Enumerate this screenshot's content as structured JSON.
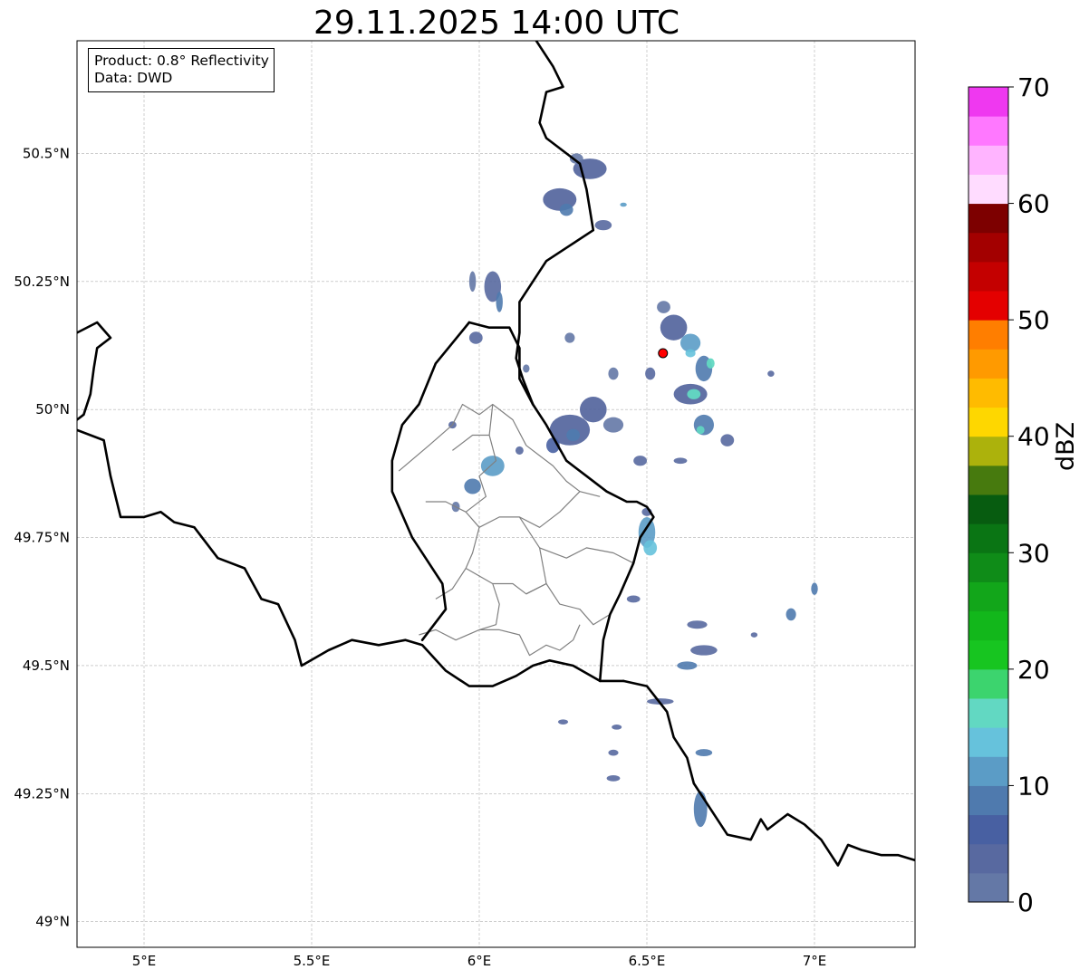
{
  "title": "29.11.2025 14:00 UTC",
  "info": {
    "product": "Product: 0.8° Reflectivity",
    "data": "Data: DWD"
  },
  "map": {
    "lon_range": [
      4.8,
      7.3
    ],
    "lat_range": [
      48.95,
      50.72
    ],
    "x_ticks": [
      {
        "value": 5.0,
        "label": "5°E"
      },
      {
        "value": 5.5,
        "label": "5.5°E"
      },
      {
        "value": 6.0,
        "label": "6°E"
      },
      {
        "value": 6.5,
        "label": "6.5°E"
      },
      {
        "value": 7.0,
        "label": "7°E"
      }
    ],
    "y_ticks": [
      {
        "value": 49.0,
        "label": "49°N"
      },
      {
        "value": 49.25,
        "label": "49.25°N"
      },
      {
        "value": 49.5,
        "label": "49.5°N"
      },
      {
        "value": 49.75,
        "label": "49.75°N"
      },
      {
        "value": 50.0,
        "label": "50°N"
      },
      {
        "value": 50.25,
        "label": "50.25°N"
      },
      {
        "value": 50.5,
        "label": "50.5°N"
      }
    ],
    "gridlines": true,
    "radar_site": {
      "lon": 6.548,
      "lat": 50.11,
      "color": "#ff0000"
    }
  },
  "colorbar": {
    "label": "dBZ",
    "min": 0,
    "max": 70,
    "step": 2.5,
    "ticks": [
      0,
      10,
      20,
      30,
      40,
      50,
      60,
      70
    ],
    "colors": [
      "#6478a6",
      "#5869a0",
      "#4860a2",
      "#4f7aae",
      "#5b9cc6",
      "#66c2dc",
      "#62d8c2",
      "#3cd46e",
      "#17c520",
      "#12b71b",
      "#12a61a",
      "#0f8c18",
      "#0a7514",
      "#075c10",
      "#477a0e",
      "#acb20c",
      "#fed700",
      "#ffbb00",
      "#ff9a00",
      "#ff7e00",
      "#e40000",
      "#c40000",
      "#a30000",
      "#7d0000",
      "#ffdcff",
      "#ffb4ff",
      "#ff78ff",
      "#ef38f0"
    ]
  },
  "borders": {
    "national": [
      [
        [
          4.8,
          50.15
        ],
        [
          4.86,
          50.17
        ],
        [
          4.9,
          50.14
        ],
        [
          4.86,
          50.12
        ],
        [
          4.85,
          50.08
        ],
        [
          4.84,
          50.03
        ],
        [
          4.82,
          49.99
        ],
        [
          4.8,
          49.98
        ]
      ],
      [
        [
          4.8,
          49.96
        ],
        [
          4.88,
          49.94
        ],
        [
          4.9,
          49.87
        ],
        [
          4.93,
          49.79
        ],
        [
          5.0,
          49.79
        ],
        [
          5.05,
          49.8
        ],
        [
          5.09,
          49.78
        ],
        [
          5.15,
          49.77
        ],
        [
          5.22,
          49.71
        ],
        [
          5.3,
          49.69
        ],
        [
          5.35,
          49.63
        ],
        [
          5.4,
          49.62
        ],
        [
          5.45,
          49.55
        ],
        [
          5.47,
          49.5
        ],
        [
          5.55,
          49.53
        ],
        [
          5.62,
          49.55
        ],
        [
          5.7,
          49.54
        ],
        [
          5.78,
          49.55
        ],
        [
          5.83,
          49.54
        ],
        [
          5.9,
          49.49
        ],
        [
          5.97,
          49.46
        ],
        [
          6.04,
          49.46
        ],
        [
          6.11,
          49.48
        ],
        [
          6.16,
          49.5
        ],
        [
          6.21,
          49.51
        ],
        [
          6.28,
          49.5
        ],
        [
          6.36,
          49.47
        ],
        [
          6.43,
          49.47
        ]
      ],
      [
        [
          6.43,
          49.47
        ],
        [
          6.5,
          49.46
        ],
        [
          6.56,
          49.41
        ],
        [
          6.58,
          49.36
        ],
        [
          6.62,
          49.32
        ],
        [
          6.64,
          49.27
        ],
        [
          6.69,
          49.22
        ],
        [
          6.74,
          49.17
        ],
        [
          6.81,
          49.16
        ],
        [
          6.84,
          49.2
        ],
        [
          6.86,
          49.18
        ],
        [
          6.92,
          49.21
        ],
        [
          6.97,
          49.19
        ],
        [
          7.02,
          49.16
        ],
        [
          7.05,
          49.13
        ],
        [
          7.07,
          49.11
        ],
        [
          7.1,
          49.15
        ],
        [
          7.14,
          49.14
        ],
        [
          7.2,
          49.13
        ],
        [
          7.25,
          49.13
        ],
        [
          7.3,
          49.12
        ]
      ],
      [
        [
          6.36,
          49.47
        ],
        [
          6.37,
          49.55
        ],
        [
          6.39,
          49.6
        ],
        [
          6.42,
          49.64
        ],
        [
          6.46,
          49.7
        ],
        [
          6.48,
          49.75
        ],
        [
          6.52,
          49.79
        ],
        [
          6.5,
          49.81
        ],
        [
          6.47,
          49.82
        ],
        [
          6.44,
          49.82
        ],
        [
          6.38,
          49.84
        ],
        [
          6.32,
          49.87
        ],
        [
          6.26,
          49.9
        ],
        [
          6.2,
          49.97
        ],
        [
          6.16,
          50.01
        ],
        [
          6.12,
          50.06
        ],
        [
          6.12,
          50.12
        ],
        [
          6.09,
          50.16
        ],
        [
          6.03,
          50.16
        ],
        [
          5.97,
          50.17
        ]
      ],
      [
        [
          5.97,
          50.17
        ],
        [
          5.92,
          50.13
        ],
        [
          5.87,
          50.09
        ],
        [
          5.82,
          50.01
        ],
        [
          5.77,
          49.97
        ],
        [
          5.74,
          49.9
        ],
        [
          5.74,
          49.84
        ],
        [
          5.8,
          49.75
        ],
        [
          5.84,
          49.71
        ],
        [
          5.89,
          49.66
        ],
        [
          5.9,
          49.61
        ],
        [
          5.83,
          49.55
        ]
      ],
      [
        [
          6.16,
          50.01
        ],
        [
          6.13,
          50.06
        ],
        [
          6.11,
          50.1
        ],
        [
          6.12,
          50.15
        ],
        [
          6.12,
          50.21
        ],
        [
          6.16,
          50.25
        ],
        [
          6.2,
          50.29
        ],
        [
          6.27,
          50.32
        ],
        [
          6.34,
          50.35
        ],
        [
          6.32,
          50.43
        ],
        [
          6.3,
          50.48
        ],
        [
          6.2,
          50.53
        ],
        [
          6.18,
          50.56
        ],
        [
          6.2,
          50.62
        ],
        [
          6.25,
          50.63
        ],
        [
          6.22,
          50.67
        ],
        [
          6.17,
          50.72
        ]
      ]
    ],
    "regional": [
      [
        [
          5.76,
          49.88
        ],
        [
          5.85,
          49.93
        ],
        [
          5.92,
          49.97
        ],
        [
          5.95,
          50.01
        ],
        [
          6.0,
          49.99
        ],
        [
          6.04,
          50.01
        ],
        [
          6.1,
          49.98
        ],
        [
          6.14,
          49.93
        ],
        [
          6.18,
          49.91
        ],
        [
          6.22,
          49.89
        ],
        [
          6.26,
          49.86
        ],
        [
          6.3,
          49.84
        ]
      ],
      [
        [
          6.04,
          50.01
        ],
        [
          6.03,
          49.95
        ],
        [
          6.05,
          49.9
        ],
        [
          6.0,
          49.87
        ],
        [
          6.02,
          49.83
        ],
        [
          5.96,
          49.8
        ],
        [
          5.9,
          49.82
        ],
        [
          5.84,
          49.82
        ]
      ],
      [
        [
          6.03,
          49.95
        ],
        [
          5.98,
          49.95
        ],
        [
          5.92,
          49.92
        ]
      ],
      [
        [
          5.96,
          49.8
        ],
        [
          6.0,
          49.77
        ],
        [
          6.06,
          49.79
        ],
        [
          6.12,
          49.79
        ],
        [
          6.18,
          49.77
        ],
        [
          6.24,
          49.8
        ],
        [
          6.3,
          49.84
        ],
        [
          6.36,
          49.83
        ]
      ],
      [
        [
          6.0,
          49.77
        ],
        [
          5.98,
          49.72
        ],
        [
          5.96,
          49.69
        ]
      ],
      [
        [
          6.12,
          49.79
        ],
        [
          6.18,
          49.73
        ],
        [
          6.26,
          49.71
        ],
        [
          6.32,
          49.73
        ],
        [
          6.4,
          49.72
        ],
        [
          6.46,
          49.7
        ]
      ],
      [
        [
          6.18,
          49.73
        ],
        [
          6.2,
          49.66
        ],
        [
          6.14,
          49.64
        ]
      ],
      [
        [
          5.96,
          49.69
        ],
        [
          6.04,
          49.66
        ],
        [
          6.1,
          49.66
        ],
        [
          6.14,
          49.64
        ],
        [
          6.2,
          49.66
        ],
        [
          6.24,
          49.62
        ],
        [
          6.3,
          49.61
        ],
        [
          6.34,
          49.58
        ],
        [
          6.39,
          49.6
        ]
      ],
      [
        [
          6.04,
          49.66
        ],
        [
          6.06,
          49.62
        ],
        [
          6.05,
          49.58
        ],
        [
          6.0,
          49.57
        ]
      ],
      [
        [
          5.87,
          49.63
        ],
        [
          5.92,
          49.65
        ],
        [
          5.96,
          49.69
        ]
      ],
      [
        [
          6.0,
          49.57
        ],
        [
          6.06,
          49.57
        ],
        [
          6.12,
          49.56
        ],
        [
          6.15,
          49.52
        ],
        [
          6.2,
          49.54
        ],
        [
          6.24,
          49.53
        ],
        [
          6.28,
          49.55
        ],
        [
          6.3,
          49.58
        ]
      ],
      [
        [
          5.82,
          49.56
        ],
        [
          5.87,
          49.57
        ],
        [
          5.93,
          49.55
        ],
        [
          6.0,
          49.57
        ]
      ]
    ]
  },
  "echoes": [
    {
      "lon": 6.24,
      "lat": 50.41,
      "rx": 0.05,
      "ry": 0.022,
      "c": "#5869a0",
      "o": 0.95
    },
    {
      "lon": 6.26,
      "lat": 50.39,
      "rx": 0.02,
      "ry": 0.012,
      "c": "#4f7aae",
      "o": 0.9
    },
    {
      "lon": 6.33,
      "lat": 50.47,
      "rx": 0.05,
      "ry": 0.02,
      "c": "#5869a0",
      "o": 0.95
    },
    {
      "lon": 6.29,
      "lat": 50.49,
      "rx": 0.02,
      "ry": 0.01,
      "c": "#6478a6",
      "o": 0.9
    },
    {
      "lon": 6.37,
      "lat": 50.36,
      "rx": 0.025,
      "ry": 0.01,
      "c": "#5869a0",
      "o": 0.9
    },
    {
      "lon": 6.43,
      "lat": 50.4,
      "rx": 0.01,
      "ry": 0.004,
      "c": "#5b9cc6",
      "o": 0.9
    },
    {
      "lon": 6.04,
      "lat": 50.24,
      "rx": 0.025,
      "ry": 0.03,
      "c": "#5869a0",
      "o": 0.9
    },
    {
      "lon": 5.98,
      "lat": 50.25,
      "rx": 0.01,
      "ry": 0.02,
      "c": "#6478a6",
      "o": 0.9
    },
    {
      "lon": 6.06,
      "lat": 50.21,
      "rx": 0.01,
      "ry": 0.02,
      "c": "#4f7aae",
      "o": 0.9
    },
    {
      "lon": 5.99,
      "lat": 50.14,
      "rx": 0.02,
      "ry": 0.012,
      "c": "#5869a0",
      "o": 0.9
    },
    {
      "lon": 6.27,
      "lat": 49.96,
      "rx": 0.06,
      "ry": 0.03,
      "c": "#5869a0",
      "o": 0.95
    },
    {
      "lon": 6.28,
      "lat": 49.95,
      "rx": 0.02,
      "ry": 0.012,
      "c": "#4f7aae",
      "o": 0.95
    },
    {
      "lon": 6.34,
      "lat": 50.0,
      "rx": 0.04,
      "ry": 0.025,
      "c": "#5869a0",
      "o": 0.95
    },
    {
      "lon": 6.4,
      "lat": 49.97,
      "rx": 0.03,
      "ry": 0.015,
      "c": "#6478a6",
      "o": 0.9
    },
    {
      "lon": 6.22,
      "lat": 49.93,
      "rx": 0.02,
      "ry": 0.015,
      "c": "#4860a2",
      "o": 0.9
    },
    {
      "lon": 6.04,
      "lat": 49.89,
      "rx": 0.035,
      "ry": 0.02,
      "c": "#5b9cc6",
      "o": 0.9
    },
    {
      "lon": 5.98,
      "lat": 49.85,
      "rx": 0.025,
      "ry": 0.015,
      "c": "#4f7aae",
      "o": 0.9
    },
    {
      "lon": 5.93,
      "lat": 49.81,
      "rx": 0.012,
      "ry": 0.01,
      "c": "#6478a6",
      "o": 0.9
    },
    {
      "lon": 5.92,
      "lat": 49.97,
      "rx": 0.012,
      "ry": 0.007,
      "c": "#5869a0",
      "o": 0.9
    },
    {
      "lon": 6.58,
      "lat": 50.16,
      "rx": 0.04,
      "ry": 0.025,
      "c": "#5869a0",
      "o": 0.95
    },
    {
      "lon": 6.63,
      "lat": 50.13,
      "rx": 0.03,
      "ry": 0.018,
      "c": "#5b9cc6",
      "o": 0.9
    },
    {
      "lon": 6.67,
      "lat": 50.08,
      "rx": 0.025,
      "ry": 0.025,
      "c": "#4f7aae",
      "o": 0.9
    },
    {
      "lon": 6.69,
      "lat": 50.09,
      "rx": 0.012,
      "ry": 0.01,
      "c": "#62d8c2",
      "o": 0.95
    },
    {
      "lon": 6.63,
      "lat": 50.03,
      "rx": 0.05,
      "ry": 0.02,
      "c": "#5869a0",
      "o": 0.95
    },
    {
      "lon": 6.64,
      "lat": 50.03,
      "rx": 0.02,
      "ry": 0.01,
      "c": "#62d8c2",
      "o": 0.95
    },
    {
      "lon": 6.63,
      "lat": 50.11,
      "rx": 0.015,
      "ry": 0.008,
      "c": "#66c2dc",
      "o": 0.9
    },
    {
      "lon": 6.67,
      "lat": 49.97,
      "rx": 0.03,
      "ry": 0.02,
      "c": "#4f7aae",
      "o": 0.9
    },
    {
      "lon": 6.66,
      "lat": 49.96,
      "rx": 0.012,
      "ry": 0.008,
      "c": "#62d8c2",
      "o": 0.9
    },
    {
      "lon": 6.55,
      "lat": 50.2,
      "rx": 0.02,
      "ry": 0.012,
      "c": "#6478a6",
      "o": 0.9
    },
    {
      "lon": 6.51,
      "lat": 50.07,
      "rx": 0.015,
      "ry": 0.012,
      "c": "#5869a0",
      "o": 0.9
    },
    {
      "lon": 6.5,
      "lat": 49.76,
      "rx": 0.025,
      "ry": 0.03,
      "c": "#5b9cc6",
      "o": 0.9
    },
    {
      "lon": 6.51,
      "lat": 49.73,
      "rx": 0.02,
      "ry": 0.015,
      "c": "#66c2dc",
      "o": 0.9
    },
    {
      "lon": 6.5,
      "lat": 49.8,
      "rx": 0.015,
      "ry": 0.008,
      "c": "#5869a0",
      "o": 0.9
    },
    {
      "lon": 6.65,
      "lat": 49.58,
      "rx": 0.03,
      "ry": 0.008,
      "c": "#5869a0",
      "o": 0.9
    },
    {
      "lon": 6.67,
      "lat": 49.53,
      "rx": 0.04,
      "ry": 0.01,
      "c": "#5869a0",
      "o": 0.9
    },
    {
      "lon": 6.62,
      "lat": 49.5,
      "rx": 0.03,
      "ry": 0.008,
      "c": "#4f7aae",
      "o": 0.9
    },
    {
      "lon": 6.54,
      "lat": 49.43,
      "rx": 0.04,
      "ry": 0.006,
      "c": "#5869a0",
      "o": 0.9
    },
    {
      "lon": 6.66,
      "lat": 49.22,
      "rx": 0.02,
      "ry": 0.035,
      "c": "#4f7aae",
      "o": 0.9
    },
    {
      "lon": 6.67,
      "lat": 49.33,
      "rx": 0.025,
      "ry": 0.007,
      "c": "#4f7aae",
      "o": 0.9
    },
    {
      "lon": 6.93,
      "lat": 49.6,
      "rx": 0.015,
      "ry": 0.012,
      "c": "#4f7aae",
      "o": 0.9
    },
    {
      "lon": 7.0,
      "lat": 49.65,
      "rx": 0.01,
      "ry": 0.012,
      "c": "#4f7aae",
      "o": 0.9
    },
    {
      "lon": 6.48,
      "lat": 49.9,
      "rx": 0.02,
      "ry": 0.01,
      "c": "#5869a0",
      "o": 0.9
    },
    {
      "lon": 6.6,
      "lat": 49.9,
      "rx": 0.02,
      "ry": 0.006,
      "c": "#5869a0",
      "o": 0.9
    },
    {
      "lon": 6.46,
      "lat": 49.63,
      "rx": 0.02,
      "ry": 0.007,
      "c": "#5869a0",
      "o": 0.9
    },
    {
      "lon": 6.4,
      "lat": 49.33,
      "rx": 0.015,
      "ry": 0.006,
      "c": "#5869a0",
      "o": 0.9
    },
    {
      "lon": 6.4,
      "lat": 49.28,
      "rx": 0.02,
      "ry": 0.006,
      "c": "#5869a0",
      "o": 0.9
    },
    {
      "lon": 6.25,
      "lat": 49.39,
      "rx": 0.015,
      "ry": 0.005,
      "c": "#5869a0",
      "o": 0.9
    },
    {
      "lon": 6.41,
      "lat": 49.38,
      "rx": 0.015,
      "ry": 0.005,
      "c": "#5869a0",
      "o": 0.9
    },
    {
      "lon": 6.82,
      "lat": 49.56,
      "rx": 0.01,
      "ry": 0.005,
      "c": "#5869a0",
      "o": 0.9
    },
    {
      "lon": 6.27,
      "lat": 50.14,
      "rx": 0.015,
      "ry": 0.01,
      "c": "#6478a6",
      "o": 0.9
    },
    {
      "lon": 6.14,
      "lat": 50.08,
      "rx": 0.01,
      "ry": 0.008,
      "c": "#6478a6",
      "o": 0.9
    },
    {
      "lon": 6.4,
      "lat": 50.07,
      "rx": 0.015,
      "ry": 0.012,
      "c": "#6478a6",
      "o": 0.9
    },
    {
      "lon": 6.87,
      "lat": 50.07,
      "rx": 0.01,
      "ry": 0.006,
      "c": "#5869a0",
      "o": 0.9
    },
    {
      "lon": 6.74,
      "lat": 49.94,
      "rx": 0.02,
      "ry": 0.012,
      "c": "#5869a0",
      "o": 0.9
    },
    {
      "lon": 6.12,
      "lat": 49.92,
      "rx": 0.012,
      "ry": 0.008,
      "c": "#5869a0",
      "o": 0.9
    }
  ]
}
